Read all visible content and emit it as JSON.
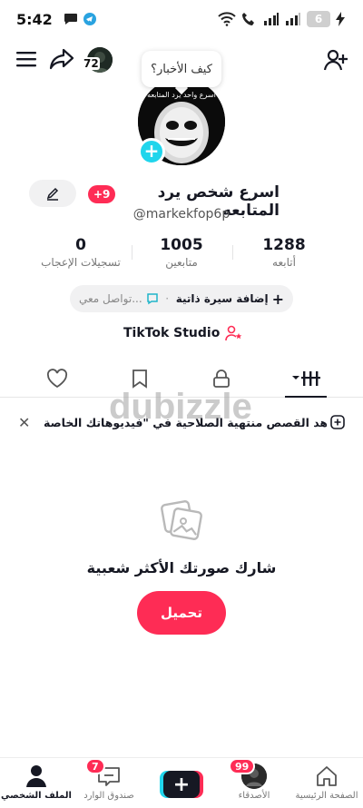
{
  "status_bar": {
    "time": "5:42",
    "battery": "6"
  },
  "top_bar": {
    "follower_avatar_count": "72"
  },
  "note": {
    "text": "كيف الأخبار؟"
  },
  "avatar": {
    "caption": "اسرع واحد يرد المتابعه"
  },
  "profile": {
    "badge": "+9",
    "display_name": "اسرع شخص يرد المتابعه",
    "username": "@markekfop6p"
  },
  "stats": [
    {
      "value": "1288",
      "label": "أتابعه"
    },
    {
      "value": "1005",
      "label": "متابعين"
    },
    {
      "value": "0",
      "label": "تسجيلات الإعجاب"
    }
  ],
  "bio": {
    "add_label": "إضافة سيرة ذاتية",
    "separator": "·",
    "contact_label": "تواصل معي..."
  },
  "studio": {
    "label": "TikTok Studio"
  },
  "tabs": [
    {
      "name": "videos"
    },
    {
      "name": "private"
    },
    {
      "name": "saved"
    },
    {
      "name": "liked"
    }
  ],
  "banner": {
    "text": "شاهد القصص منتهية الصلاحية في \"فيديوهاتك الخاصة\""
  },
  "watermark": {
    "text": "dubizzle"
  },
  "empty_state": {
    "message": "شارك صورتك الأكثر شعبية",
    "upload_label": "تحميل"
  },
  "bottom_nav": {
    "home": "الصفحة الرئيسية",
    "friends": "الأصدقاء",
    "friends_badge": "99",
    "inbox": "صندوق الوارد",
    "inbox_badge": "7",
    "profile": "الملف الشخصي"
  },
  "colors": {
    "accent": "#fe2c55",
    "cyan": "#20d5ec",
    "text": "#161823"
  }
}
